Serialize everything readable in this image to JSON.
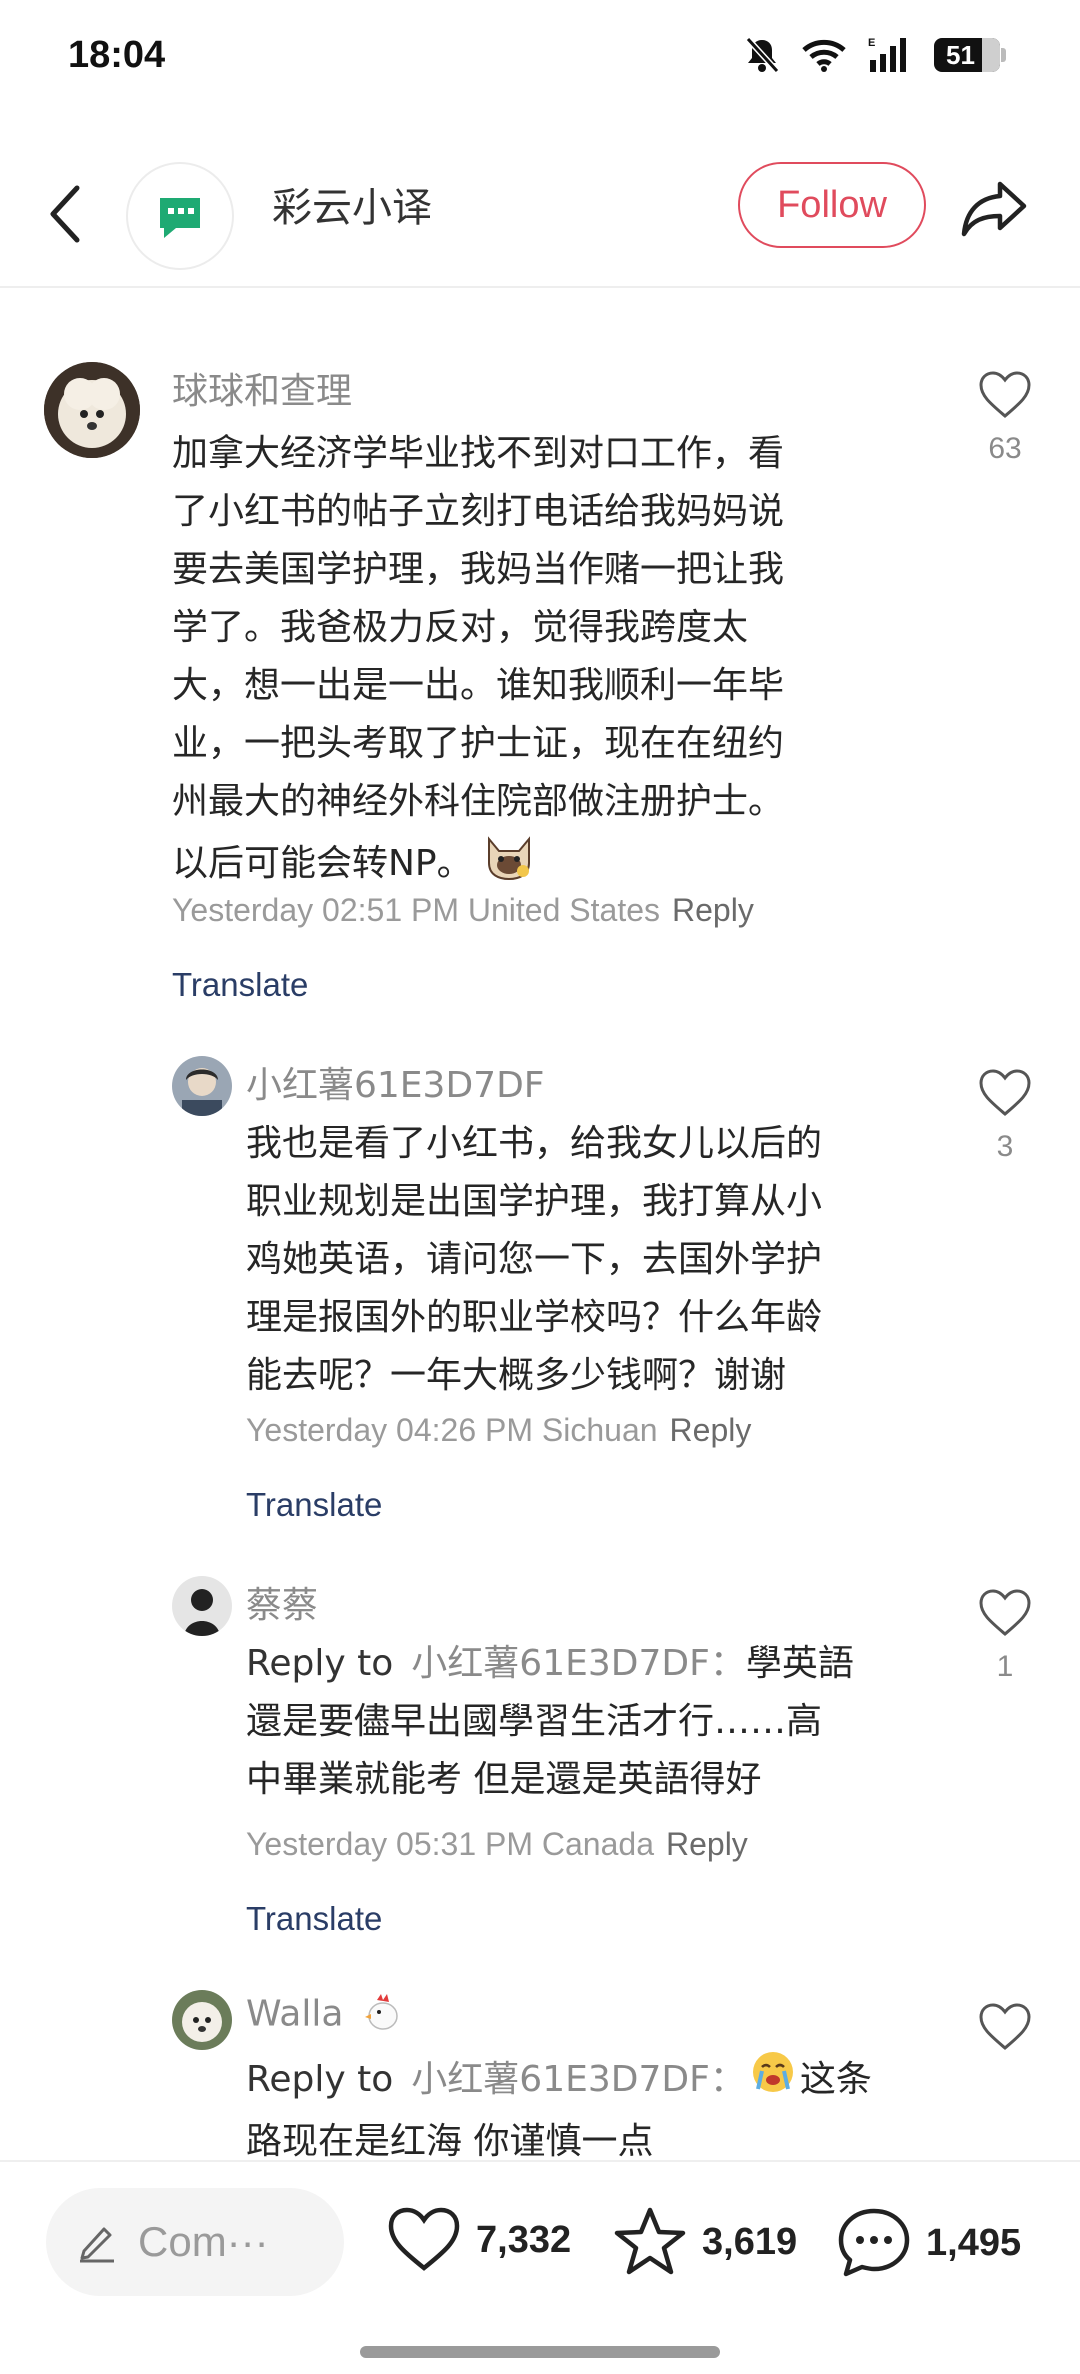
{
  "status_bar": {
    "time": "18:04",
    "battery_level": "51"
  },
  "header": {
    "author_name": "彩云小译",
    "follow_label": "Follow",
    "accent_color": "#e04b5d"
  },
  "comments": [
    {
      "username": "球球和查理",
      "text_lines": [
        "加拿大经济学毕业找不到对口工作，看",
        "了小红书的帖子立刻打电话给我妈妈说",
        "要去美国学护理，我妈当作赌一把让我",
        "学了。我爸极力反对，觉得我跨度太",
        "大，想一出是一出。谁知我顺利一年毕",
        "业，一把头考取了护士证，现在在纽约",
        "州最大的神经外科住院部做注册护士。",
        "以后可能会转NP。"
      ],
      "meta": "Yesterday 02:51 PM United States",
      "reply_label": "Reply",
      "translate_label": "Translate",
      "likes": "63"
    },
    {
      "username": "小红薯61E3D7DF",
      "text_lines": [
        "我也是看了小红书，给我女儿以后的",
        "职业规划是出国学护理，我打算从小",
        "鸡她英语，请问您一下，去国外学护",
        "理是报国外的职业学校吗？什么年龄",
        "能去呢？一年大概多少钱啊？谢谢"
      ],
      "meta": "Yesterday 04:26 PM Sichuan",
      "reply_label": "Reply",
      "translate_label": "Translate",
      "likes": "3"
    },
    {
      "username": "蔡蔡",
      "reply_prefix": "Reply to",
      "reply_target": "小红薯61E3D7DF",
      "text_lines": [
        "學英語",
        "還是要儘早出國學習生活才行……高",
        "中畢業就能考 但是還是英語得好"
      ],
      "meta": "Yesterday 05:31 PM Canada",
      "reply_label": "Reply",
      "translate_label": "Translate",
      "likes": "1"
    },
    {
      "username": "Walla",
      "reply_prefix": "Reply to",
      "reply_target": "小红薯61E3D7DF",
      "text_lines": [
        "这条",
        "路现在是红海 你谨慎一点"
      ]
    }
  ],
  "bottom_bar": {
    "comment_placeholder": "Com···",
    "likes": "7,332",
    "collects": "3,619",
    "comments": "1,495"
  }
}
